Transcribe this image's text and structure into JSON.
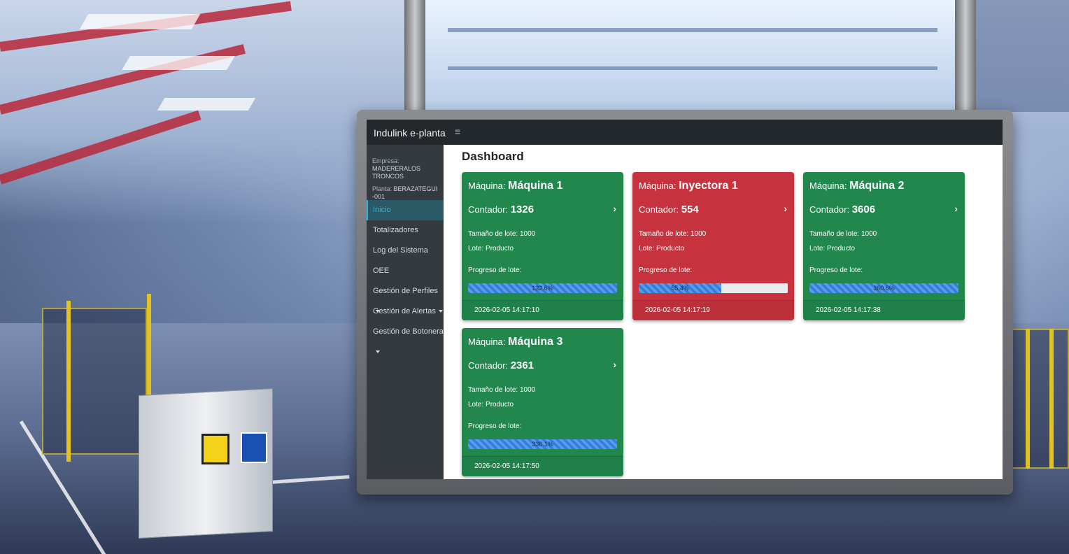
{
  "app": {
    "brand": "Indulink e-planta",
    "menu_icon": "≡"
  },
  "sidebar": {
    "empresa_label": "Empresa:",
    "empresa_value": "MADERERALOS TRONCOS",
    "planta_label": "Planta:",
    "planta_value": "BERAZATEGUI -001",
    "items": [
      {
        "label": "Inicio",
        "active": true
      },
      {
        "label": "Totalizadores"
      },
      {
        "label": "Log del Sistema"
      },
      {
        "label": "OEE"
      },
      {
        "label": "Gestión de Perfiles",
        "dropdown": true
      },
      {
        "label": "Gestión de Alertas",
        "dropdown": true
      },
      {
        "label": "Gestión de Botonera",
        "dropdown": true
      }
    ]
  },
  "main": {
    "title": "Dashboard",
    "labels": {
      "machine": "Máquina:",
      "counter": "Contador:",
      "lot_size": "Tamaño de lote:",
      "lot": "Lote:",
      "progress": "Progreso de lote:"
    },
    "cards": [
      {
        "name": "Máquina 1",
        "counter": "1326",
        "lot_size": "1000",
        "lot": "Producto",
        "progress_text": "132.6%",
        "progress": 1.326,
        "timestamp": "2026-02-05 14:17:10",
        "status": "green"
      },
      {
        "name": "Inyectora 1",
        "counter": "554",
        "lot_size": "1000",
        "lot": "Producto",
        "progress_text": "55.4%",
        "progress": 0.554,
        "timestamp": "2026-02-05 14:17:19",
        "status": "red"
      },
      {
        "name": "Máquina 2",
        "counter": "3606",
        "lot_size": "1000",
        "lot": "Producto",
        "progress_text": "360.6%",
        "progress": 3.606,
        "timestamp": "2026-02-05 14:17:38",
        "status": "green"
      },
      {
        "name": "Máquina 3",
        "counter": "2361",
        "lot_size": "1000",
        "lot": "Producto",
        "progress_text": "336.1%",
        "progress": 3.361,
        "timestamp": "2026-02-05 14:17:50",
        "status": "green"
      }
    ]
  },
  "colors": {
    "topbar": "#23282d",
    "sidebar": "#343a40",
    "status_green": "#22874d",
    "status_red": "#c6333f",
    "progress": "#2f7fe0",
    "active_nav": "#3fb0d6"
  },
  "icons": {
    "menu": "hamburger-icon",
    "card_link": "chevron-right-icon",
    "dropdown": "caret-down-icon"
  }
}
